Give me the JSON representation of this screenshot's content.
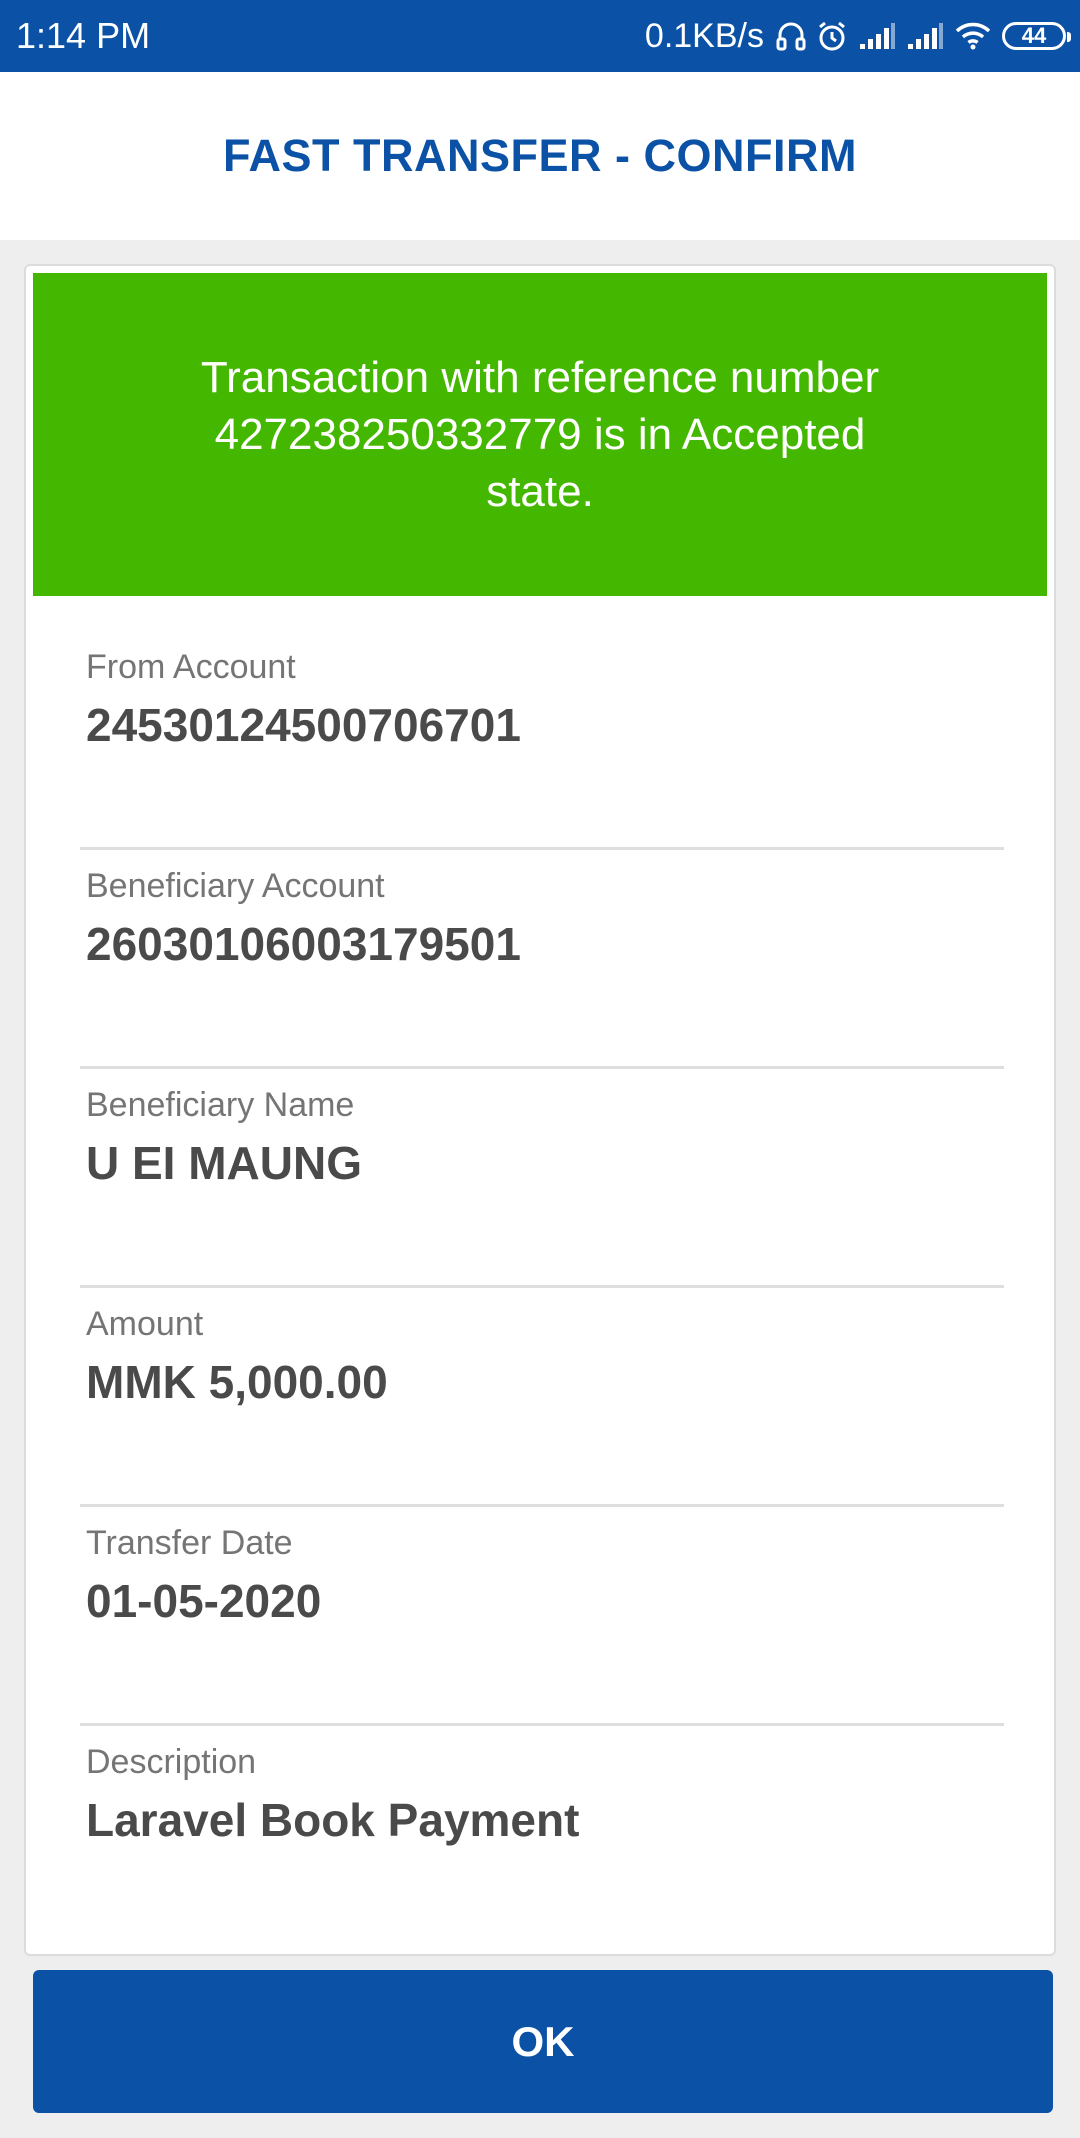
{
  "status_bar": {
    "time": "1:14 PM",
    "network_speed": "0.1KB/s",
    "battery_level": "44",
    "icons": [
      "headset-icon",
      "alarm-icon",
      "signal-icon",
      "signal-icon",
      "wifi-icon",
      "battery-icon"
    ]
  },
  "header": {
    "title": "FAST TRANSFER - CONFIRM"
  },
  "banner": {
    "message": "Transaction with reference  number\n427238250332779 is in Accepted\nstate.",
    "color": "#44b700"
  },
  "fields": [
    {
      "label": "From Account",
      "value": "24530124500706701"
    },
    {
      "label": "Beneficiary Account",
      "value": "26030106003179501"
    },
    {
      "label": "Beneficiary Name",
      "value": "U EI MAUNG"
    },
    {
      "label": "Amount",
      "value": "MMK 5,000.00"
    },
    {
      "label": "Transfer Date",
      "value": "01-05-2020"
    },
    {
      "label": "Description",
      "value": "Laravel Book Payment"
    }
  ],
  "actions": {
    "ok_label": "OK"
  },
  "colors": {
    "primary": "#0b52a6",
    "success": "#44b700",
    "background": "#eeeeee"
  }
}
